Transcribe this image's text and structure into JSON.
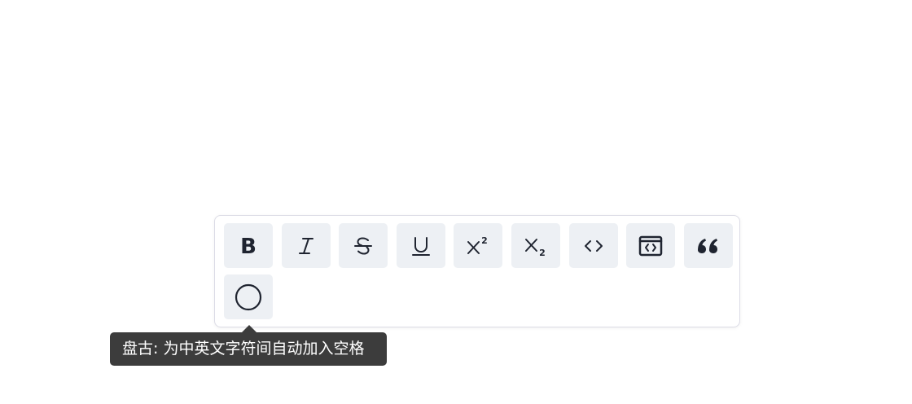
{
  "toolbar": {
    "buttons": [
      {
        "name": "bold",
        "icon": "bold-icon"
      },
      {
        "name": "italic",
        "icon": "italic-icon"
      },
      {
        "name": "strikethrough",
        "icon": "strikethrough-icon"
      },
      {
        "name": "underline",
        "icon": "underline-icon"
      },
      {
        "name": "superscript",
        "icon": "superscript-icon"
      },
      {
        "name": "subscript",
        "icon": "subscript-icon"
      },
      {
        "name": "inline-code",
        "icon": "code-icon"
      },
      {
        "name": "code-block",
        "icon": "code-block-icon"
      },
      {
        "name": "quote",
        "icon": "quote-icon"
      },
      {
        "name": "pangu",
        "icon": "circle-icon"
      }
    ]
  },
  "tooltip": {
    "text": "盘古: 为中英文字符间自动加入空格"
  },
  "colors": {
    "button_bg": "#edf0f4",
    "icon": "#1f2430",
    "tooltip_bg": "#3c3c3c",
    "border": "#dcdce6"
  }
}
